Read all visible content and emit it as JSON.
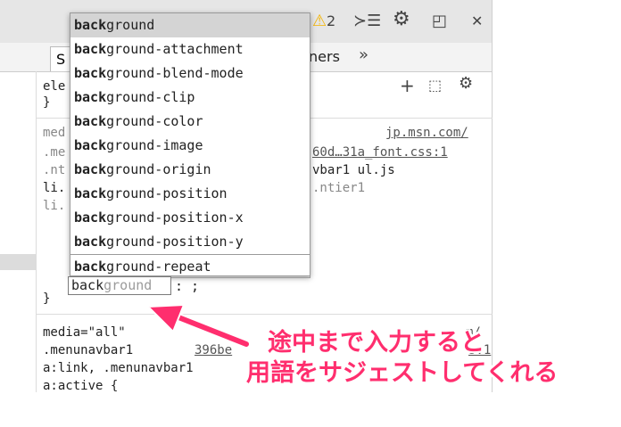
{
  "toolbar": {
    "warning_count": "2",
    "icons": [
      "warning-icon",
      "console-drawer-icon",
      "settings-gear-icon",
      "dock-icon",
      "close-icon"
    ],
    "accent": "#f4b400"
  },
  "subtabs": {
    "styles_tab_visible": "S",
    "other_tab_tail": "ners",
    "overflow": "»"
  },
  "rules": {
    "line1": "ele",
    "line1_close": "}",
    "media_partial": "med",
    "source_url": "jp.msn.com/",
    "selector_me": ".me",
    "font_css": "60d…31a_font.css:1",
    "selector_nt": ".nt",
    "vbar": "vbar1 ul.js",
    "li1": "li.",
    "ntier": ".ntier1",
    "li2": "li.",
    "brace_close": "}",
    "media_all": "media=\"all\"",
    "source_tail": "m/",
    "menunavbar": ".menunavbar1",
    "src2_a": "396be",
    "src2_b": "s:1",
    "alink": "a:link, .menunavbar1",
    "active": "a:active {"
  },
  "autocomplete": {
    "typed_prefix": "back",
    "items": [
      {
        "bold": "back",
        "rest": "ground"
      },
      {
        "bold": "back",
        "rest": "ground-attachment"
      },
      {
        "bold": "back",
        "rest": "ground-blend-mode"
      },
      {
        "bold": "back",
        "rest": "ground-clip"
      },
      {
        "bold": "back",
        "rest": "ground-color"
      },
      {
        "bold": "back",
        "rest": "ground-image"
      },
      {
        "bold": "back",
        "rest": "ground-origin"
      },
      {
        "bold": "back",
        "rest": "ground-position"
      },
      {
        "bold": "back",
        "rest": "ground-position-x"
      },
      {
        "bold": "back",
        "rest": "ground-position-y"
      },
      {
        "bold": "back",
        "rest": "ground-repeat"
      }
    ]
  },
  "editor": {
    "typed": "back",
    "suggestion": "ground",
    "suffix": ": ;"
  },
  "annotation": {
    "line1": "途中まで入力すると",
    "line2": "用語をサジェストしてくれる",
    "color": "#ff2e6e"
  }
}
